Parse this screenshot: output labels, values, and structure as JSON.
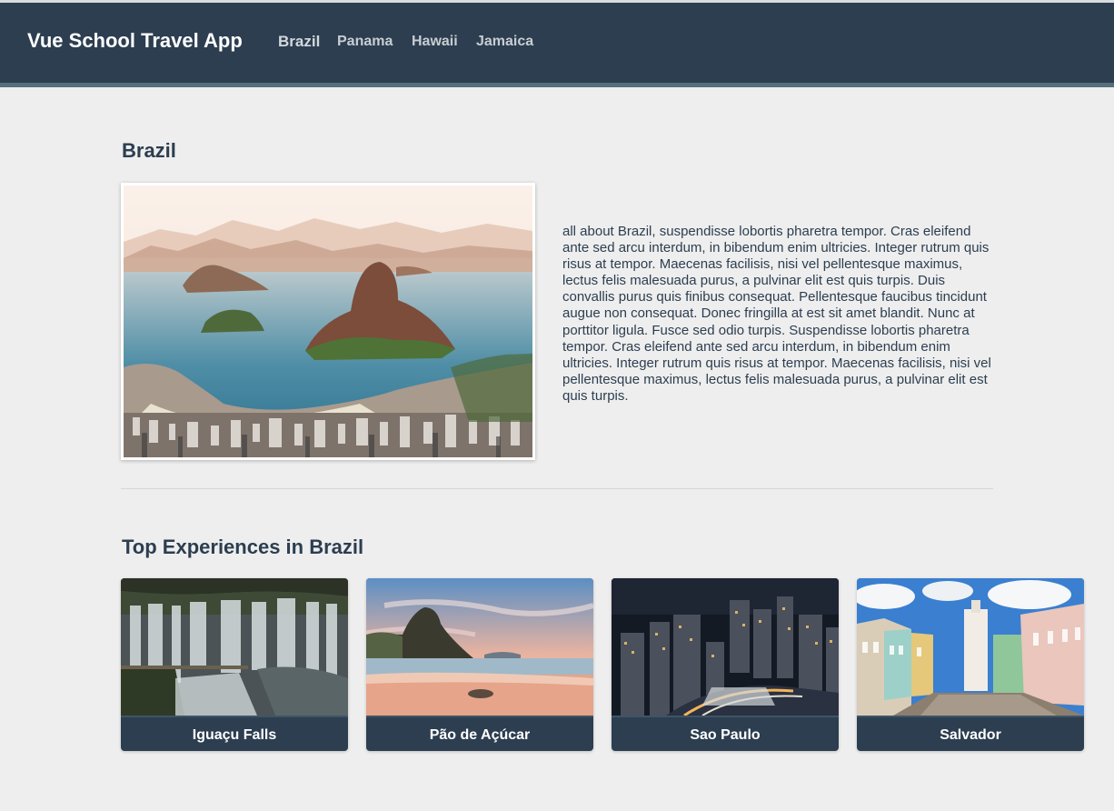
{
  "header": {
    "brand": "Vue School Travel App",
    "nav": [
      "Brazil",
      "Panama",
      "Hawaii",
      "Jamaica"
    ]
  },
  "destination": {
    "name": "Brazil",
    "description": "all about Brazil, suspendisse lobortis pharetra tempor. Cras eleifend ante sed arcu interdum, in bibendum enim ultricies. Integer rutrum quis risus at tempor. Maecenas facilisis, nisi vel pellentesque maximus, lectus felis malesuada purus, a pulvinar elit est quis turpis. Duis convallis purus quis finibus consequat. Pellentesque faucibus tincidunt augue non consequat. Donec fringilla at est sit amet blandit. Nunc at porttitor ligula. Fusce sed odio turpis. Suspendisse lobortis pharetra tempor. Cras eleifend ante sed arcu interdum, in bibendum enim ultricies. Integer rutrum quis risus at tempor. Maecenas facilisis, nisi vel pellentesque maximus, lectus felis malesuada purus, a pulvinar elit est quis turpis."
  },
  "experiences": {
    "title": "Top Experiences in Brazil",
    "items": [
      {
        "name": "Iguaçu Falls"
      },
      {
        "name": "Pão de Açúcar"
      },
      {
        "name": "Sao Paulo"
      },
      {
        "name": "Salvador"
      }
    ]
  },
  "colors": {
    "navbar": "#2c3e50",
    "navbar_border": "#54707a",
    "page_background": "#eeeeee",
    "text": "#2c3e50"
  }
}
